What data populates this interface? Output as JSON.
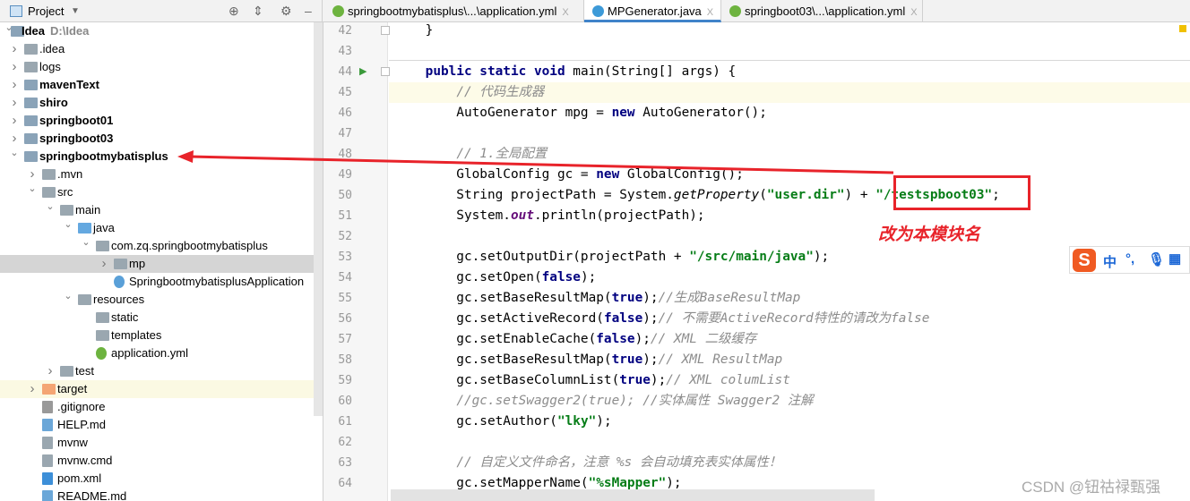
{
  "project_panel": {
    "title": "Project",
    "icons": [
      "dropdown-icon",
      "locate-icon",
      "collapse-icon",
      "gear-icon",
      "minimize-icon"
    ]
  },
  "tabs": [
    {
      "label": "springbootmybatisplus\\...\\application.yml",
      "active": false,
      "icon": "spring-yml-icon",
      "color": "#6db33f"
    },
    {
      "label": "MPGenerator.java",
      "active": true,
      "icon": "java-class-icon",
      "color": "#3d9ad8"
    },
    {
      "label": "springboot03\\...\\application.yml",
      "active": false,
      "icon": "spring-yml-icon",
      "color": "#6db33f"
    }
  ],
  "tab_close": "X",
  "tree": [
    {
      "label": "Idea",
      "sub": "D:\\Idea",
      "depth": 0,
      "arrow": "open",
      "bold": true,
      "icon": "module"
    },
    {
      "label": ".idea",
      "depth": 1,
      "arrow": "closed",
      "icon": "folder"
    },
    {
      "label": "logs",
      "depth": 1,
      "arrow": "closed",
      "icon": "folder"
    },
    {
      "label": "mavenText",
      "depth": 1,
      "arrow": "closed",
      "bold": true,
      "icon": "module"
    },
    {
      "label": "shiro",
      "depth": 1,
      "arrow": "closed",
      "bold": true,
      "icon": "module"
    },
    {
      "label": "springboot01",
      "depth": 1,
      "arrow": "closed",
      "bold": true,
      "icon": "module"
    },
    {
      "label": "springboot03",
      "depth": 1,
      "arrow": "closed",
      "bold": true,
      "icon": "module"
    },
    {
      "label": "springbootmybatisplus",
      "depth": 1,
      "arrow": "open",
      "bold": true,
      "icon": "module"
    },
    {
      "label": ".mvn",
      "depth": 2,
      "arrow": "closed",
      "icon": "folder"
    },
    {
      "label": "src",
      "depth": 2,
      "arrow": "open",
      "icon": "folder"
    },
    {
      "label": "main",
      "depth": 3,
      "arrow": "open",
      "icon": "folder"
    },
    {
      "label": "java",
      "depth": 4,
      "arrow": "open",
      "icon": "source-folder"
    },
    {
      "label": "com.zq.springbootmybatisplus",
      "depth": 5,
      "arrow": "open",
      "icon": "package"
    },
    {
      "label": "mp",
      "depth": 6,
      "arrow": "closed",
      "icon": "package",
      "selected": true
    },
    {
      "label": "SpringbootmybatisplusApplication",
      "depth": 6,
      "arrow": "none",
      "icon": "spring-class"
    },
    {
      "label": "resources",
      "depth": 4,
      "arrow": "open",
      "icon": "resources-folder"
    },
    {
      "label": "static",
      "depth": 5,
      "arrow": "none",
      "icon": "folder"
    },
    {
      "label": "templates",
      "depth": 5,
      "arrow": "none",
      "icon": "folder"
    },
    {
      "label": "application.yml",
      "depth": 5,
      "arrow": "none",
      "icon": "spring-yml"
    },
    {
      "label": "test",
      "depth": 3,
      "arrow": "closed",
      "icon": "folder"
    },
    {
      "label": "target",
      "depth": 2,
      "arrow": "closed",
      "icon": "excluded-folder",
      "highlight": true
    },
    {
      "label": ".gitignore",
      "depth": 2,
      "arrow": "none",
      "icon": "ignore-file"
    },
    {
      "label": "HELP.md",
      "depth": 2,
      "arrow": "none",
      "icon": "markdown-file"
    },
    {
      "label": "mvnw",
      "depth": 2,
      "arrow": "none",
      "icon": "shell-file"
    },
    {
      "label": "mvnw.cmd",
      "depth": 2,
      "arrow": "none",
      "icon": "text-file"
    },
    {
      "label": "pom.xml",
      "depth": 2,
      "arrow": "none",
      "icon": "maven-file"
    },
    {
      "label": "README.md",
      "depth": 2,
      "arrow": "none",
      "icon": "markdown-file"
    }
  ],
  "code": [
    {
      "n": "42",
      "t": [
        [
          "    }",
          ""
        ]
      ]
    },
    {
      "n": "43",
      "t": []
    },
    {
      "n": "44",
      "run": true,
      "t": [
        [
          "    ",
          ""
        ],
        [
          "public static void ",
          "kw"
        ],
        [
          "main(String[] args) {",
          ""
        ]
      ]
    },
    {
      "n": "45",
      "current": true,
      "t": [
        [
          "        ",
          ""
        ],
        [
          "// 代码生成器",
          "cm"
        ]
      ]
    },
    {
      "n": "46",
      "t": [
        [
          "        AutoGenerator mpg = ",
          ""
        ],
        [
          "new ",
          "kw"
        ],
        [
          "AutoGenerator();",
          ""
        ]
      ]
    },
    {
      "n": "47",
      "t": []
    },
    {
      "n": "48",
      "t": [
        [
          "        ",
          ""
        ],
        [
          "// 1.全局配置",
          "cm"
        ]
      ]
    },
    {
      "n": "49",
      "t": [
        [
          "        GlobalConfig gc = ",
          ""
        ],
        [
          "new ",
          "kw"
        ],
        [
          "GlobalConfig();",
          ""
        ]
      ]
    },
    {
      "n": "50",
      "t": [
        [
          "        String projectPath = System.",
          ""
        ],
        [
          "getProperty",
          "it"
        ],
        [
          "(",
          ""
        ],
        [
          "\"user.dir\"",
          "str"
        ],
        [
          ") + ",
          ""
        ],
        [
          "\"/testspboot03\"",
          "str"
        ],
        [
          ";",
          ""
        ]
      ]
    },
    {
      "n": "51",
      "t": [
        [
          "        System.",
          ""
        ],
        [
          "out",
          "fld"
        ],
        [
          ".println(projectPath);",
          ""
        ]
      ]
    },
    {
      "n": "52",
      "t": []
    },
    {
      "n": "53",
      "t": [
        [
          "        gc.setOutputDir(projectPath + ",
          ""
        ],
        [
          "\"/src/main/java\"",
          "str"
        ],
        [
          ");",
          ""
        ]
      ]
    },
    {
      "n": "54",
      "t": [
        [
          "        gc.setOpen(",
          ""
        ],
        [
          "false",
          "kw"
        ],
        [
          ");",
          ""
        ]
      ]
    },
    {
      "n": "55",
      "t": [
        [
          "        gc.setBaseResultMap(",
          ""
        ],
        [
          "true",
          "kw"
        ],
        [
          ");",
          ""
        ],
        [
          "//生成BaseResultMap",
          "cm"
        ]
      ]
    },
    {
      "n": "56",
      "t": [
        [
          "        gc.setActiveRecord(",
          ""
        ],
        [
          "false",
          "kw"
        ],
        [
          ");",
          ""
        ],
        [
          "// 不需要ActiveRecord特性的请改为false",
          "cm"
        ]
      ]
    },
    {
      "n": "57",
      "t": [
        [
          "        gc.setEnableCache(",
          ""
        ],
        [
          "false",
          "kw"
        ],
        [
          ");",
          ""
        ],
        [
          "// XML 二级缓存",
          "cm"
        ]
      ]
    },
    {
      "n": "58",
      "t": [
        [
          "        gc.setBaseResultMap(",
          ""
        ],
        [
          "true",
          "kw"
        ],
        [
          ");",
          ""
        ],
        [
          "// XML ResultMap",
          "cm"
        ]
      ]
    },
    {
      "n": "59",
      "t": [
        [
          "        gc.setBaseColumnList(",
          ""
        ],
        [
          "true",
          "kw"
        ],
        [
          ");",
          ""
        ],
        [
          "// XML columList",
          "cm"
        ]
      ]
    },
    {
      "n": "60",
      "t": [
        [
          "        ",
          ""
        ],
        [
          "//gc.setSwagger2(true); //实体属性 Swagger2 注解",
          "cm"
        ]
      ]
    },
    {
      "n": "61",
      "t": [
        [
          "        gc.setAuthor(",
          ""
        ],
        [
          "\"lky\"",
          "str"
        ],
        [
          ");",
          ""
        ]
      ]
    },
    {
      "n": "62",
      "t": []
    },
    {
      "n": "63",
      "t": [
        [
          "        ",
          ""
        ],
        [
          "// 自定义文件命名，注意 %s 会自动填充表实体属性！",
          "cm"
        ]
      ]
    },
    {
      "n": "64",
      "t": [
        [
          "        gc.setMapperName(",
          ""
        ],
        [
          "\"%sMapper\"",
          "str"
        ],
        [
          ");",
          ""
        ]
      ]
    }
  ],
  "annotation": {
    "text": "改为本模块名",
    "color": "#e8232a"
  },
  "ime": {
    "logo": "S",
    "mode": "中",
    "punct": "°,",
    "icons": [
      "microphone-icon",
      "keyboard-icon"
    ]
  },
  "watermark": "CSDN @钮祜禄甄强"
}
